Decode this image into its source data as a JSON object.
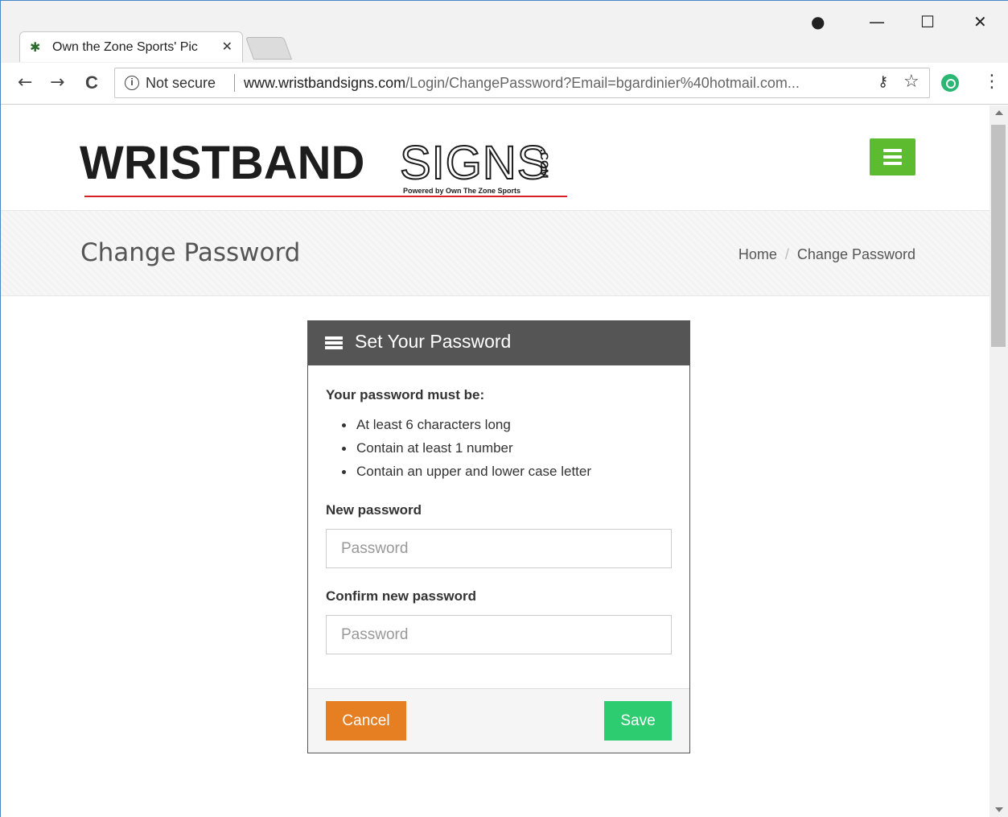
{
  "browser": {
    "tab_title": "Own the Zone Sports' Pic",
    "tab_close": "✕",
    "favicon": "✱",
    "security_label": "Not secure",
    "url_host": "www.wristbandsigns.com",
    "url_path": "/Login/ChangePassword?Email=bgardinier%40hotmail.com...",
    "controls": {
      "minimize": "—",
      "maximize": "☐",
      "close": "✕",
      "profile": "●"
    },
    "nav": {
      "back": "←",
      "forward": "→",
      "reload": "C"
    },
    "icons": {
      "key": "key-icon",
      "star": "star-icon",
      "extension": "extension-icon",
      "menu": "menu-dots-icon"
    }
  },
  "site": {
    "logo_main": "WRISTBAND",
    "logo_signs": "SIGNS",
    "logo_com": ".COM",
    "logo_powered": "Powered by Own The Zone Sports",
    "accent_color": "#5dbb2f",
    "logo_red": "#d91f26"
  },
  "title_band": {
    "title": "Change Password",
    "breadcrumb": {
      "home": "Home",
      "separator": "/",
      "current": "Change Password"
    }
  },
  "panel": {
    "title": "Set Your Password",
    "rules_title": "Your password must be:",
    "rules": [
      "At least 6 characters long",
      "Contain at least 1 number",
      "Contain an upper and lower case letter"
    ],
    "new_password": {
      "label": "New password",
      "placeholder": "Password",
      "value": ""
    },
    "confirm_password": {
      "label": "Confirm new password",
      "placeholder": "Password",
      "value": ""
    },
    "buttons": {
      "cancel": "Cancel",
      "save": "Save"
    },
    "colors": {
      "cancel": "#e67e22",
      "save": "#2ecc71",
      "header": "#555555"
    }
  }
}
